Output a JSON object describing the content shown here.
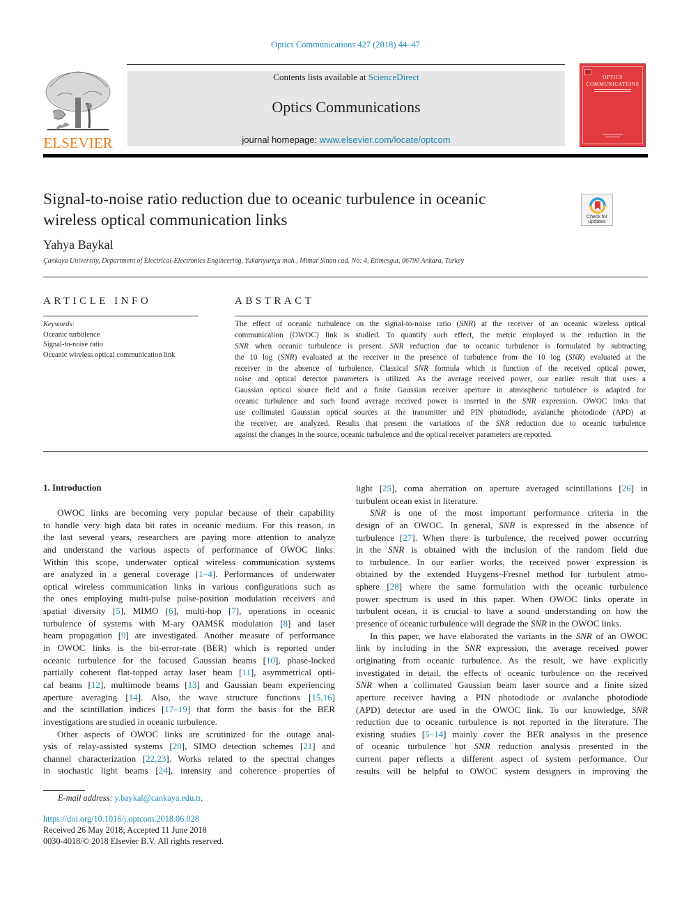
{
  "header": {
    "journal_ref": "Optics Communications 427 (2018) 44–47",
    "contents_prefix": "Contents lists available at ",
    "contents_link": "ScienceDirect",
    "journal_name": "Optics Communications",
    "homepage_prefix": "journal homepage: ",
    "homepage_link": "www.elsevier.com/locate/optcom",
    "publisher_logo_text": "ELSEVIER",
    "cover": {
      "line1": "OPTICS",
      "line2": "COMMUNICATIONS",
      "color": "#e23b3f"
    },
    "check_updates": {
      "line1": "Check for",
      "line2": "updates"
    }
  },
  "article": {
    "title_lines": [
      "Signal-to-noise ratio reduction due to oceanic turbulence in oceanic",
      "wireless optical communication links"
    ],
    "author": "Yahya Baykal",
    "affiliation": "Çankaya University, Department of Electrical-Electronics Engineering, Yukarıyurtçu mah., Mimar Sinan cad. No: 4, Etimesgut, 06790 Ankara, Turkey"
  },
  "article_info": {
    "heading": "ARTICLE INFO",
    "keywords_label": "Keywords:",
    "keywords": [
      "Oceanic turbulence",
      "Signal-to-noise ratio",
      "Oceanic wireless optical communication link"
    ]
  },
  "abstract": {
    "heading": "ABSTRACT",
    "lines": [
      "The effect of oceanic turbulence on the signal-to-noise ratio (SNR) at the receiver of an oceanic wireless optical",
      "communication (OWOC) link is studied. To quantify such effect, the metric employed is the reduction in the",
      "SNR when oceanic turbulence is present. SNR reduction due to oceanic turbulence is formulated by subtracting",
      "the 10 log (SNR) evaluated at the receiver in the presence of turbulence from the 10 log (SNR) evaluated at the",
      "receiver in the absence of turbulence. Classical SNR formula which is function of the received optical power,",
      "noise and optical detector parameters is utilized. As the average received power, our earlier result that uses a",
      "Gaussian optical source field and a finite Gaussian receiver aperture in atmospheric turbulence is adapted for",
      "oceanic turbulence and such found average received power is inserted in the SNR expression. OWOC links that",
      "use collimated Gaussian optical sources at the transmitter and PIN photodiode, avalanche photodiode (APD) at",
      "the receiver, are analyzed. Results that present the variations of the SNR reduction due to oceanic turbulence",
      "against the changes in the source, oceanic turbulence and the optical receiver parameters are reported."
    ]
  },
  "introduction": {
    "heading": "1.  Introduction",
    "left_lines": [
      {
        "t": "OWOC links are becoming very popular because of their capability",
        "indent": true
      },
      {
        "t": "to handle very high data bit rates in oceanic medium. For this reason, in"
      },
      {
        "t": "the last several years, researchers are paying more attention to analyze"
      },
      {
        "t": "and understand the various aspects of performance of OWOC links."
      },
      {
        "t": "Within this scope, underwater optical wireless communication systems"
      },
      {
        "t": "are analyzed in a general coverage [1–4]. Performances of underwater"
      },
      {
        "t": "optical wireless communication links in various configurations such as"
      },
      {
        "t": "the ones employing multi-pulse pulse-position modulation receivers and"
      },
      {
        "t": "spatial diversity [5], MIMO [6], multi-hop [7], operations in oceanic"
      },
      {
        "t": "turbulence of systems with M-ary OAMSK modulation [8] and laser"
      },
      {
        "t": "beam propagation [9] are investigated. Another measure of performance"
      },
      {
        "t": "in OWOC links is the bit-error-rate (BER) which is reported under"
      },
      {
        "t": "oceanic turbulence for the focused Gaussian beams [10], phase-locked"
      },
      {
        "t": "partially coherent flat-topped array laser beam [11], asymmetrical opti-"
      },
      {
        "t": "cal beams [12], multimode beams [13] and Gaussian beam experiencing"
      },
      {
        "t": "aperture averaging [14]. Also, the wave structure functions [15,16]"
      },
      {
        "t": "and the scintillation indices [17–19] that form the basis for the BER"
      },
      {
        "t": "investigations are studied in oceanic turbulence.",
        "last": true
      },
      {
        "t": "Other aspects of OWOC links are scrutinized for the outage anal-",
        "indent": true
      },
      {
        "t": "ysis of relay-assisted systems [20], SIMO detection schemes [21] and"
      },
      {
        "t": "channel characterization [22,23]. Works related to the spectral changes"
      },
      {
        "t": "in stochastic light beams [24], intensity and coherence properties of"
      }
    ],
    "right_lines": [
      {
        "t": "light [25], coma aberration on aperture averaged scintillations [26] in"
      },
      {
        "t": "turbulent ocean exist in literature.",
        "last": true
      },
      {
        "t": "SNR is one of the most important performance criteria in the",
        "indent": true
      },
      {
        "t": "design of an OWOC. In general, SNR is expressed in the absence of"
      },
      {
        "t": "turbulence [27]. When there is turbulence, the received power occurring"
      },
      {
        "t": "in the SNR is obtained with the inclusion of the random field due"
      },
      {
        "t": "to turbulence. In our earlier works, the received power expression is"
      },
      {
        "t": "obtained by the extended Huygens–Fresnel method for turbulent atmo-"
      },
      {
        "t": "sphere [28] where the same formulation with the oceanic turbulence"
      },
      {
        "t": "power spectrum is used in this paper. When OWOC links operate in"
      },
      {
        "t": "turbulent ocean, it is crucial to have a sound understanding on how the"
      },
      {
        "t": "presence of oceanic turbulence will degrade the SNR in the OWOC links.",
        "last": true
      },
      {
        "t": "In this paper, we have elaborated the variants in the SNR of an OWOC",
        "indent": true
      },
      {
        "t": "link by including in the SNR expression, the average received power"
      },
      {
        "t": "originating from oceanic turbulence. As the result, we have explicitly"
      },
      {
        "t": "investigated in detail, the effects of oceanic turbulence on the received"
      },
      {
        "t": "SNR when a collimated Gaussian beam laser source and a finite sized"
      },
      {
        "t": "aperture receiver having a PIN photodiode or avalanche photodiode"
      },
      {
        "t": "(APD) detector are used in the OWOC link. To our knowledge, SNR"
      },
      {
        "t": "reduction due to oceanic turbulence is not reported in the literature. The"
      },
      {
        "t": "existing studies [5–14] mainly cover the BER analysis in the presence"
      },
      {
        "t": "of oceanic turbulence but SNR reduction analysis presented in the"
      },
      {
        "t": "current paper reflects a different aspect of system performance. Our"
      },
      {
        "t": "results will be helpful to OWOC system designers in improving the"
      }
    ]
  },
  "footnote": {
    "email_label": "E-mail address: ",
    "email": "y.baykal@cankaya.edu.tr",
    "email_suffix": ".",
    "doi": "https://doi.org/10.1016/j.optcom.2018.06.028",
    "received": "Received 26 May 2018; Accepted 11 June 2018",
    "copyright": "0030-4018/© 2018 Elsevier B.V. All rights reserved."
  },
  "colors": {
    "link": "#1d8bb3",
    "elsevier_orange": "#f07f1b",
    "cover_red": "#e23b3f",
    "banner_gray": "#e6e6e6"
  }
}
